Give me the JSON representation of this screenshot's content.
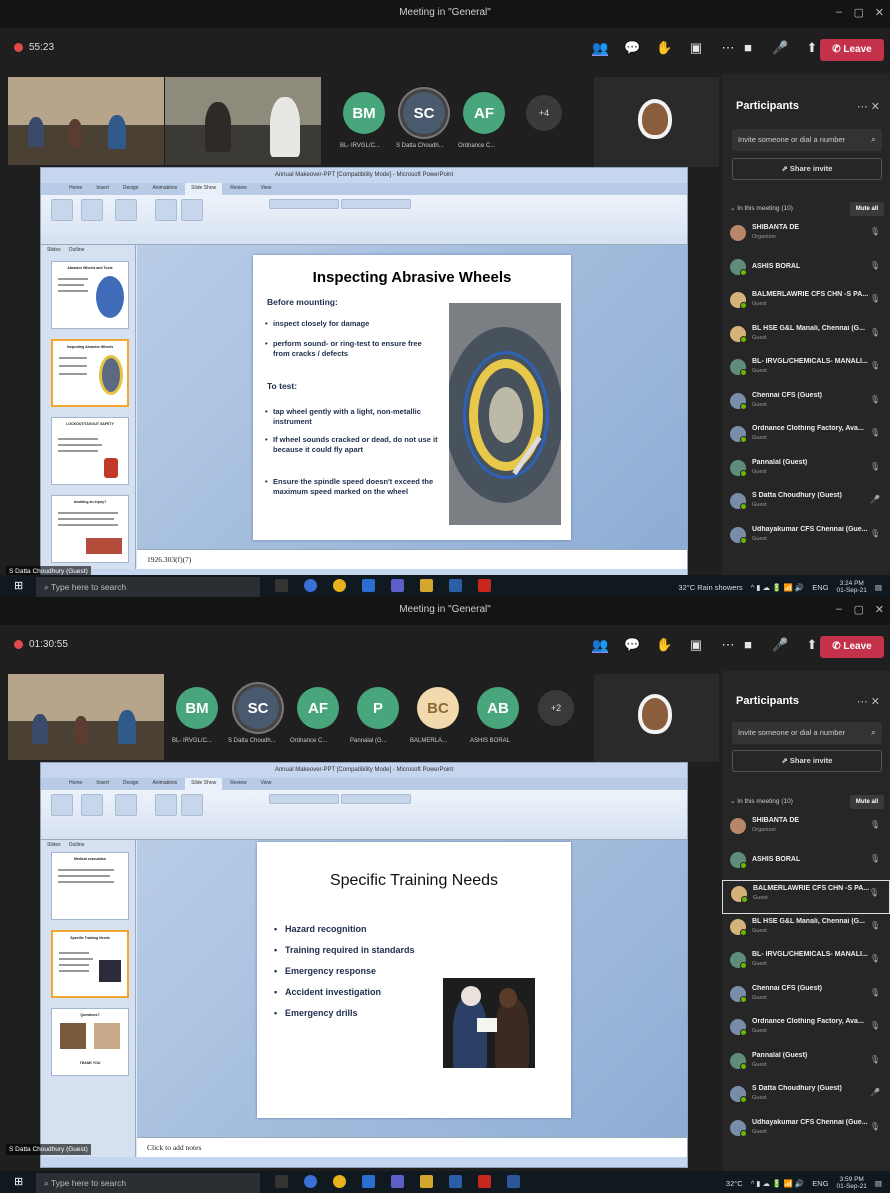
{
  "window_title": "Meeting in \"General\"",
  "screens": [
    {
      "timer": "55:23",
      "avatars": [
        {
          "initials": "BM",
          "label": "BL- IRVGL/C...",
          "color": "#49a67c"
        },
        {
          "initials": "SC",
          "label": "S Datta Choudh...",
          "color": "#4a5a6e"
        },
        {
          "initials": "AF",
          "label": "Ordnance C...",
          "color": "#49a67c"
        }
      ],
      "more_count": "+4",
      "panel": {
        "title": "Participants",
        "invite_placeholder": "Invite someone or dial a number",
        "share_invite": "Share invite",
        "in_meeting": "In this meeting (10)",
        "mute_all": "Mute all",
        "participants": [
          {
            "name": "SHIBANTA DE",
            "role": "Organizer"
          },
          {
            "name": "ASHIS BORAL",
            "role": ""
          },
          {
            "name": "BALMERLAWRIE CFS CHN -S PA...",
            "role": "Guest"
          },
          {
            "name": "BL HSE G&L Manali, Chennai (G...",
            "role": "Guest"
          },
          {
            "name": "BL- IRVGL/CHEMICALS- MANALI...",
            "role": "Guest"
          },
          {
            "name": "Chennai CFS (Guest)",
            "role": "Guest"
          },
          {
            "name": "Ordnance Clothing Factory, Ava...",
            "role": "Guest"
          },
          {
            "name": "Pannalal (Guest)",
            "role": "Guest"
          },
          {
            "name": "S Datta Choudhury (Guest)",
            "role": "Guest"
          },
          {
            "name": "Udhayakumar CFS Chennai (Gue...",
            "role": "Guest"
          }
        ]
      },
      "ppt_title": "Annual Makeover-PPT [Compatibility Mode] - Microsoft PowerPoint",
      "ppt_tabs": [
        "Home",
        "Insert",
        "Design",
        "Animations",
        "Slide Show",
        "Review",
        "View"
      ],
      "side_tabs": [
        "Slides",
        "Outline"
      ],
      "slide": {
        "title": "Inspecting Abrasive Wheels",
        "h1": "Before mounting:",
        "b1": "inspect closely for damage",
        "b2": "perform sound- or ring-test to ensure free from cracks / defects",
        "h2": "To test:",
        "b3": "tap wheel gently with a light, non-metallic instrument",
        "b4": "If wheel sounds cracked or dead, do not use it because it could fly apart",
        "b5": "Ensure the spindle speed doesn't exceed the maximum speed marked on the wheel"
      },
      "thumbs": [
        {
          "title": "Abrasive Wheels and Tools"
        },
        {
          "title": "Inspecting Abrasive Wheels"
        },
        {
          "title": "LOCKOUT/TAGOUT SAFETY"
        },
        {
          "title": "Avoiding an Injury?"
        }
      ],
      "notes": "1926.303(f)(7)",
      "video_name": "S Datta Choudhury (Guest)",
      "taskbar": {
        "search": "Type here to search",
        "weather": "32°C  Rain showers",
        "lang": "ENG",
        "time": "3:24 PM",
        "date": "01-Sep-21"
      }
    },
    {
      "timer": "01:30:55",
      "avatars": [
        {
          "initials": "BM",
          "label": "BL- IRVGL/C...",
          "color": "#49a67c"
        },
        {
          "initials": "SC",
          "label": "S Datta Choudh...",
          "color": "#4a5a6e"
        },
        {
          "initials": "AF",
          "label": "Ordnance C...",
          "color": "#49a67c"
        },
        {
          "initials": "P",
          "label": "Pannalal (G...",
          "color": "#49a67c"
        },
        {
          "initials": "BC",
          "label": "BALMERLA...",
          "color": "#f2d9ae"
        },
        {
          "initials": "AB",
          "label": "ASHIS BORAL",
          "color": "#49a67c"
        }
      ],
      "more_count": "+2",
      "slide": {
        "title": "Specific Training Needs",
        "bullets": [
          "Hazard recognition",
          "Training required in standards",
          "Emergency response",
          "Accident investigation",
          "Emergency drills"
        ]
      },
      "thumbs": [
        {
          "title": "Medical evacuation"
        },
        {
          "title": "Specific Training Needs"
        },
        {
          "title": "Questions?"
        }
      ],
      "thumb_footer": "THANK YOU",
      "notes": "Click to add notes",
      "video_name": "S Datta Choudhury (Guest)",
      "taskbar": {
        "search": "Type here to search",
        "weather": "32°C",
        "lang": "ENG",
        "time": "3:59 PM",
        "date": "01-Sep-21"
      }
    }
  ]
}
